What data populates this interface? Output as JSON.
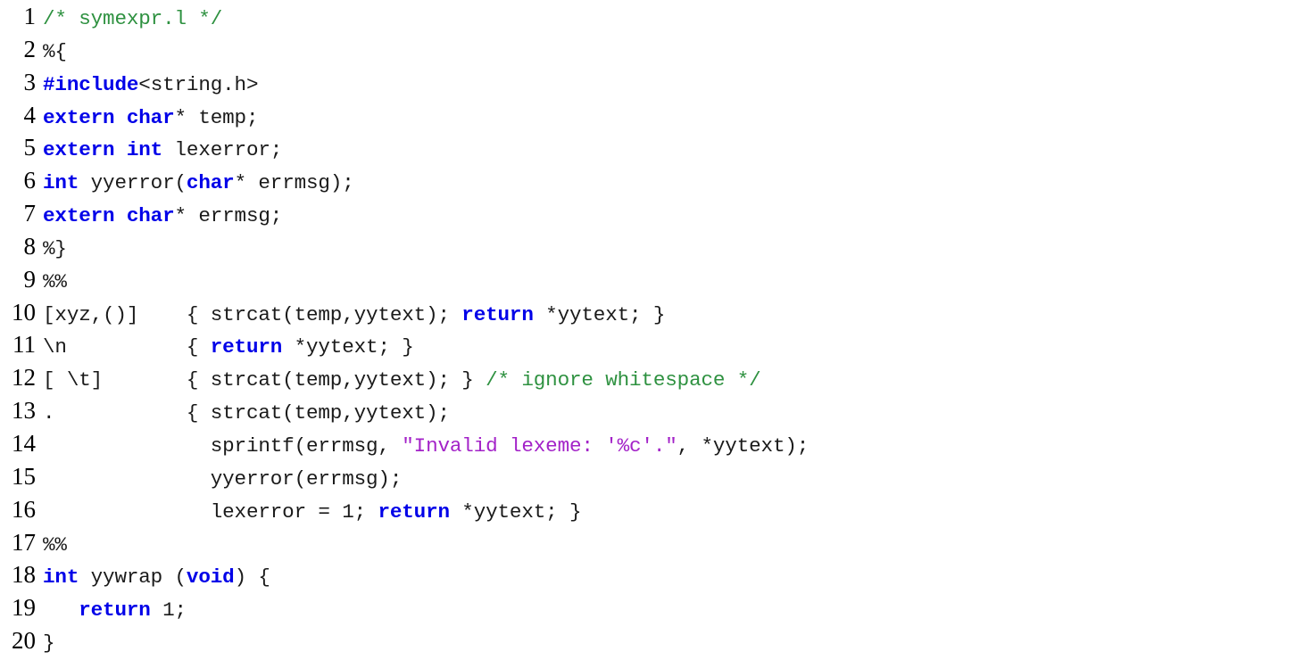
{
  "document": {
    "kind": "source-code-listing",
    "language": "lex",
    "file_comment": "/* symexpr.l */",
    "first_line_number": 1,
    "last_line_number": 20,
    "total_lines": 20
  },
  "colors": {
    "background": "#ffffff",
    "default_text": "#1a1a1a",
    "line_number": "#000000",
    "keyword": "#0000E8",
    "comment": "#2E9140",
    "string": "#A322C8"
  },
  "lines": [
    {
      "number": "1",
      "tokens": [
        {
          "t": "cmt",
          "s": "/* symexpr.l */"
        }
      ]
    },
    {
      "number": "2",
      "tokens": [
        {
          "t": "plain",
          "s": "%{"
        }
      ]
    },
    {
      "number": "3",
      "tokens": [
        {
          "t": "kw",
          "s": "#include"
        },
        {
          "t": "plain",
          "s": "<string.h>"
        }
      ]
    },
    {
      "number": "4",
      "tokens": [
        {
          "t": "kw",
          "s": "extern char"
        },
        {
          "t": "plain",
          "s": "* temp;"
        }
      ]
    },
    {
      "number": "5",
      "tokens": [
        {
          "t": "kw",
          "s": "extern int"
        },
        {
          "t": "plain",
          "s": " lexerror;"
        }
      ]
    },
    {
      "number": "6",
      "tokens": [
        {
          "t": "kw",
          "s": "int"
        },
        {
          "t": "plain",
          "s": " yyerror("
        },
        {
          "t": "kw",
          "s": "char"
        },
        {
          "t": "plain",
          "s": "* errmsg);"
        }
      ]
    },
    {
      "number": "7",
      "tokens": [
        {
          "t": "kw",
          "s": "extern char"
        },
        {
          "t": "plain",
          "s": "* errmsg;"
        }
      ]
    },
    {
      "number": "8",
      "tokens": [
        {
          "t": "plain",
          "s": "%}"
        }
      ]
    },
    {
      "number": "9",
      "tokens": [
        {
          "t": "plain",
          "s": "%%"
        }
      ]
    },
    {
      "number": "10",
      "tokens": [
        {
          "t": "plain",
          "s": "[xyz,()]    { strcat(temp,yytext); "
        },
        {
          "t": "kw",
          "s": "return"
        },
        {
          "t": "plain",
          "s": " *yytext; }"
        }
      ]
    },
    {
      "number": "11",
      "tokens": [
        {
          "t": "plain",
          "s": "\\n          { "
        },
        {
          "t": "kw",
          "s": "return"
        },
        {
          "t": "plain",
          "s": " *yytext; }"
        }
      ]
    },
    {
      "number": "12",
      "tokens": [
        {
          "t": "plain",
          "s": "[ \\t]       { strcat(temp,yytext); } "
        },
        {
          "t": "cmt",
          "s": "/* ignore whitespace */"
        }
      ]
    },
    {
      "number": "13",
      "tokens": [
        {
          "t": "plain",
          "s": ".           { strcat(temp,yytext);"
        }
      ]
    },
    {
      "number": "14",
      "tokens": [
        {
          "t": "plain",
          "s": "              sprintf(errmsg, "
        },
        {
          "t": "str",
          "s": "\"Invalid lexeme: '%c'.\""
        },
        {
          "t": "plain",
          "s": ", *yytext);"
        }
      ]
    },
    {
      "number": "15",
      "tokens": [
        {
          "t": "plain",
          "s": "              yyerror(errmsg);"
        }
      ]
    },
    {
      "number": "16",
      "tokens": [
        {
          "t": "plain",
          "s": "              lexerror = 1; "
        },
        {
          "t": "kw",
          "s": "return"
        },
        {
          "t": "plain",
          "s": " *yytext; }"
        }
      ]
    },
    {
      "number": "17",
      "tokens": [
        {
          "t": "plain",
          "s": "%%"
        }
      ]
    },
    {
      "number": "18",
      "tokens": [
        {
          "t": "kw",
          "s": "int"
        },
        {
          "t": "plain",
          "s": " yywrap ("
        },
        {
          "t": "kw",
          "s": "void"
        },
        {
          "t": "plain",
          "s": ") {"
        }
      ]
    },
    {
      "number": "19",
      "tokens": [
        {
          "t": "plain",
          "s": "   "
        },
        {
          "t": "kw",
          "s": "return"
        },
        {
          "t": "plain",
          "s": " 1;"
        }
      ]
    },
    {
      "number": "20",
      "tokens": [
        {
          "t": "plain",
          "s": "}"
        }
      ]
    }
  ]
}
